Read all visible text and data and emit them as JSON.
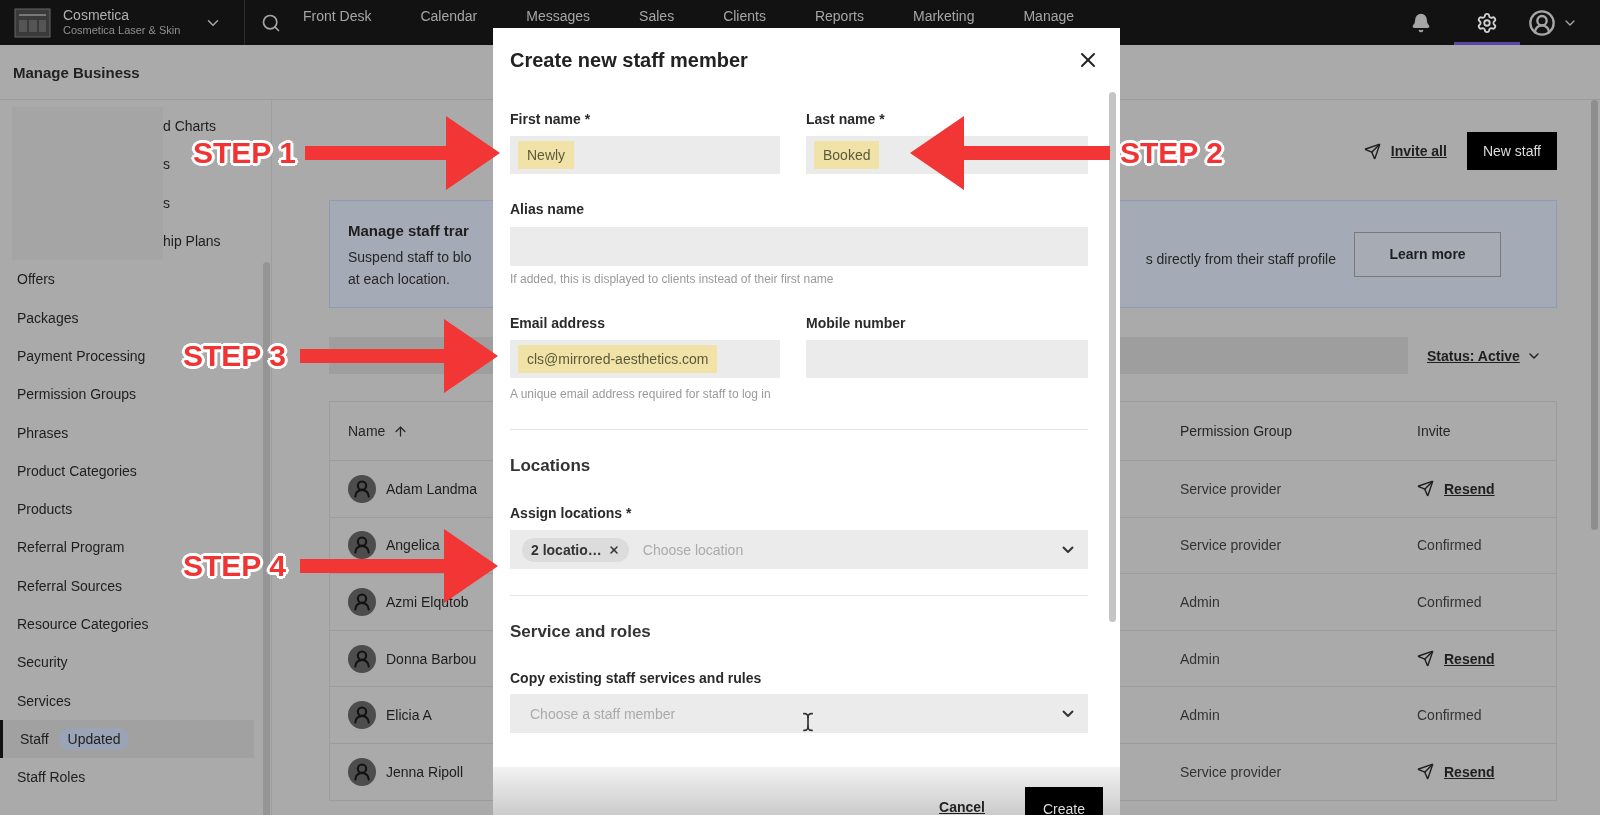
{
  "top_bar": {
    "business_name": "Cosmetica",
    "business_subtitle": "Cosmetica Laser & Skin",
    "nav": [
      {
        "label": "Front Desk"
      },
      {
        "label": "Calendar"
      },
      {
        "label": "Messages"
      },
      {
        "label": "Sales"
      },
      {
        "label": "Clients"
      },
      {
        "label": "Reports"
      },
      {
        "label": "Marketing"
      },
      {
        "label": "Manage"
      }
    ],
    "icons": [
      {
        "kind": "bell",
        "selected": false
      },
      {
        "kind": "gear",
        "selected": true
      },
      {
        "kind": "avatar",
        "selected": false
      }
    ]
  },
  "page_header": {
    "title": "Manage Business"
  },
  "sidebar": {
    "items": [
      {
        "label": "d Charts",
        "selected": false,
        "obscured": true
      },
      {
        "label": "s",
        "selected": false,
        "obscured": true
      },
      {
        "label": "s",
        "selected": false,
        "obscured": true
      },
      {
        "label": "hip Plans",
        "selected": false,
        "obscured": true
      },
      {
        "label": "Offers",
        "selected": false
      },
      {
        "label": "Packages",
        "selected": false
      },
      {
        "label": "Payment Processing",
        "selected": false
      },
      {
        "label": "Permission Groups",
        "selected": false
      },
      {
        "label": "Phrases",
        "selected": false
      },
      {
        "label": "Product Categories",
        "selected": false
      },
      {
        "label": "Products",
        "selected": false
      },
      {
        "label": "Referral Program",
        "selected": false
      },
      {
        "label": "Referral Sources",
        "selected": false
      },
      {
        "label": "Resource Categories",
        "selected": false
      },
      {
        "label": "Security",
        "selected": false
      },
      {
        "label": "Services",
        "selected": false
      },
      {
        "label": "Staff",
        "selected": true,
        "badge": "Updated"
      },
      {
        "label": "Staff Roles",
        "selected": false
      }
    ]
  },
  "staff_page": {
    "invite_all": "Invite all",
    "new_staff": "New staff",
    "banner": {
      "title": "Manage staff trar",
      "text_left": [
        "Suspend staff to blo",
        "at each location."
      ],
      "text_right": "s directly from their staff profile",
      "button": "Learn more"
    },
    "status_filter": "Status: Active",
    "table": {
      "columns": [
        {
          "label": "Name",
          "sorted": true
        },
        {
          "label": "Permission Group",
          "sorted": false
        },
        {
          "label": "Invite",
          "sorted": false
        }
      ],
      "rows": [
        {
          "name": "Adam Landma",
          "permission_group": "Service provider",
          "invite": "Resend",
          "kind": "resend"
        },
        {
          "name": "Angelica",
          "permission_group": "Service provider",
          "invite": "Confirmed",
          "kind": "status"
        },
        {
          "name": "Azmi Elqutob",
          "permission_group": "Admin",
          "invite": "Confirmed",
          "kind": "status"
        },
        {
          "name": "Donna Barbou",
          "permission_group": "Admin",
          "invite": "Resend",
          "kind": "resend"
        },
        {
          "name": "Elicia A",
          "permission_group": "Admin",
          "invite": "Confirmed",
          "kind": "status"
        },
        {
          "name": "Jenna Ripoll",
          "permission_group": "Service provider",
          "invite": "Resend",
          "kind": "resend"
        }
      ]
    }
  },
  "modal": {
    "title": "Create new staff member",
    "name_fields": [
      {
        "label": "First name *",
        "value": "Newly",
        "highlighted": true
      },
      {
        "label": "Last name *",
        "value": "Booked",
        "highlighted": true
      }
    ],
    "alias_field": {
      "label": "Alias name",
      "help": "If added, this is displayed to clients instead of their first name"
    },
    "contact_fields": [
      {
        "label": "Email address",
        "value": "cls@mirrored-aesthetics.com",
        "highlighted": true,
        "help": "A unique email address required for staff to log in"
      },
      {
        "label": "Mobile number"
      }
    ],
    "locations": {
      "heading": "Locations",
      "label": "Assign locations *",
      "chips": [
        "2 locatio…"
      ],
      "placeholder": "Choose location"
    },
    "services": {
      "heading": "Service and roles",
      "label": "Copy existing staff services and rules",
      "placeholder": "Choose a staff member"
    },
    "cancel": "Cancel",
    "create": "Create"
  },
  "annotations": [
    {
      "label": "STEP 1",
      "kind": "right"
    },
    {
      "label": "STEP 2",
      "kind": "left"
    },
    {
      "label": "STEP 3",
      "kind": "right"
    },
    {
      "label": "STEP 4",
      "kind": "right"
    }
  ]
}
